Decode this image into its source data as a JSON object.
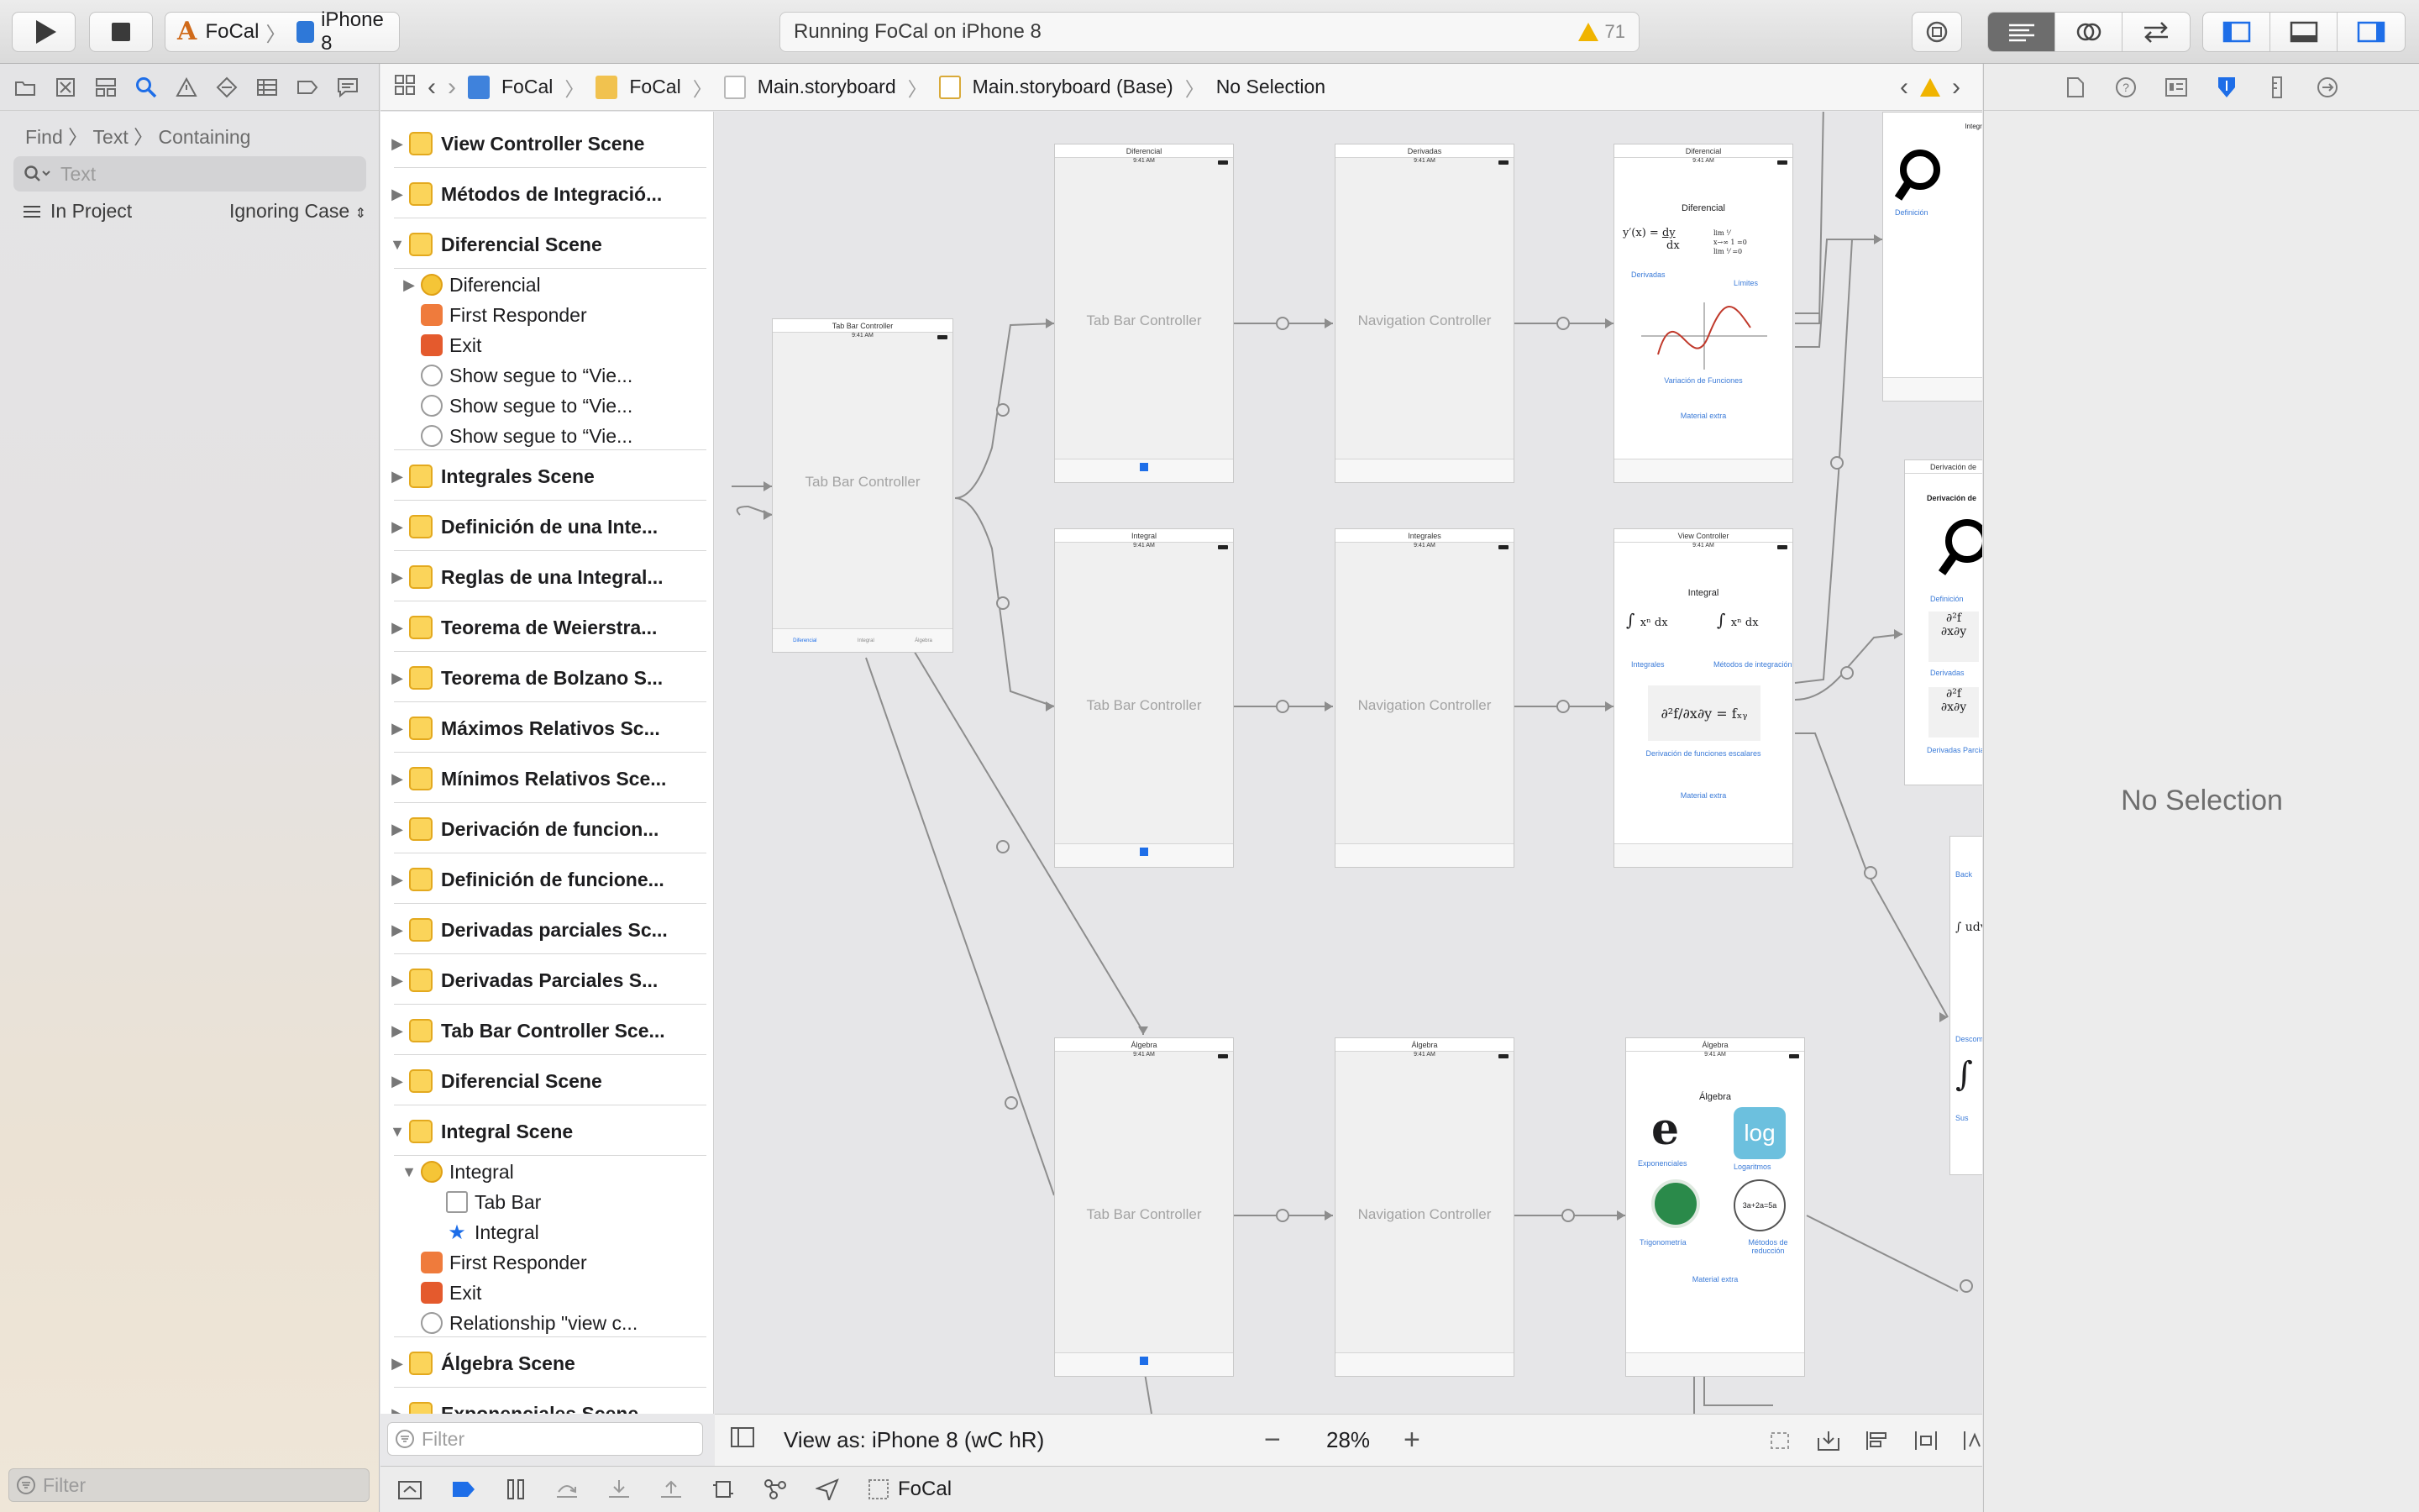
{
  "toolbar": {
    "scheme_app": "FoCal",
    "scheme_device": "iPhone 8",
    "status_text": "Running FoCal on iPhone 8",
    "warning_count": "71"
  },
  "navigator": {
    "find_path": [
      "Find",
      "Text",
      "Containing"
    ],
    "search_placeholder": "Text",
    "scope": "In Project",
    "case_option": "Ignoring Case",
    "filter_placeholder": "Filter"
  },
  "jumpbar": {
    "items": [
      "FoCal",
      "FoCal",
      "Main.storyboard",
      "Main.storyboard (Base)",
      "No Selection"
    ]
  },
  "outline": {
    "rows": [
      {
        "label": "View Controller Scene",
        "kind": "scene",
        "expanded": false
      },
      {
        "label": "Métodos de Integració...",
        "kind": "scene",
        "expanded": false
      },
      {
        "label": "Diferencial Scene",
        "kind": "scene",
        "expanded": true
      },
      {
        "label": "Diferencial",
        "kind": "vc",
        "indent": 1
      },
      {
        "label": "First Responder",
        "kind": "fr",
        "indent": 1
      },
      {
        "label": "Exit",
        "kind": "exit",
        "indent": 1
      },
      {
        "label": "Show segue to “Vie...",
        "kind": "seg",
        "indent": 1
      },
      {
        "label": "Show segue to “Vie...",
        "kind": "seg",
        "indent": 1
      },
      {
        "label": "Show segue to “Vie...",
        "kind": "seg",
        "indent": 1
      },
      {
        "label": "Integrales Scene",
        "kind": "scene",
        "expanded": false
      },
      {
        "label": "Definición de una Inte...",
        "kind": "scene",
        "expanded": false
      },
      {
        "label": "Reglas de una Integral...",
        "kind": "scene",
        "expanded": false
      },
      {
        "label": "Teorema de Weierstra...",
        "kind": "scene",
        "expanded": false
      },
      {
        "label": "Teorema de Bolzano S...",
        "kind": "scene",
        "expanded": false
      },
      {
        "label": "Máximos Relativos Sc...",
        "kind": "scene",
        "expanded": false
      },
      {
        "label": "Mínimos Relativos Sce...",
        "kind": "scene",
        "expanded": false
      },
      {
        "label": "Derivación de funcion...",
        "kind": "scene",
        "expanded": false
      },
      {
        "label": "Definición de funcione...",
        "kind": "scene",
        "expanded": false
      },
      {
        "label": "Derivadas parciales Sc...",
        "kind": "scene",
        "expanded": false
      },
      {
        "label": "Derivadas Parciales S...",
        "kind": "scene",
        "expanded": false
      },
      {
        "label": "Tab Bar Controller Sce...",
        "kind": "scene",
        "expanded": false
      },
      {
        "label": "Diferencial Scene",
        "kind": "scene",
        "expanded": false
      },
      {
        "label": "Integral Scene",
        "kind": "scene",
        "expanded": true
      },
      {
        "label": "Integral",
        "kind": "vc",
        "indent": 1,
        "expanded": true
      },
      {
        "label": "Tab Bar",
        "kind": "tab",
        "indent": 2
      },
      {
        "label": "Integral",
        "kind": "star",
        "indent": 2
      },
      {
        "label": "First Responder",
        "kind": "fr",
        "indent": 1
      },
      {
        "label": "Exit",
        "kind": "exit",
        "indent": 1
      },
      {
        "label": "Relationship \"view c...",
        "kind": "seg",
        "indent": 1
      },
      {
        "label": "Álgebra Scene",
        "kind": "scene",
        "expanded": false
      },
      {
        "label": "Exponenciales Scene",
        "kind": "scene",
        "expanded": false
      }
    ],
    "filter_placeholder": "Filter"
  },
  "canvas": {
    "status_time": "9:41 AM",
    "tab_bar_controller_label": "Tab Bar Controller",
    "navigation_controller_label": "Navigation Controller",
    "scenes": {
      "root_title": "Tab Bar Controller",
      "root_tabs": [
        "Diferencial",
        "Integral",
        "Álgebra"
      ],
      "diff_title": "Diferencial",
      "deriv_title": "Derivadas",
      "diff_vc_title": "Diferencial",
      "diff_heading": "Diferencial",
      "diff_links": [
        "Derivadas",
        "Límites",
        "Variación de Funciones",
        "Material extra"
      ],
      "int_title": "Integral",
      "integrales_title": "Integrales",
      "vc_title": "View Controller",
      "int_heading": "Integral",
      "int_links": [
        "Integrales",
        "Métodos de integración",
        "Derivación de funciones escalares",
        "Material extra"
      ],
      "alg_title": "Álgebra",
      "alg_heading": "Álgebra",
      "alg_links": [
        "Exponenciales",
        "Logaritmos",
        "Trigonometría",
        "Métodos de reducción",
        "Material extra"
      ],
      "alg_log": "log",
      "alg_red": "3a+2a=5a",
      "right_top_title": "Integral",
      "right_top_link": "Definición",
      "right_mid_title": "Derivación de",
      "right_mid_heading": "Derivación de",
      "right_mid_links": [
        "Definición",
        "Derivadas",
        "Derivadas Parcia"
      ],
      "right_low_back": "Back",
      "right_low_links": [
        "Descom",
        "Sus"
      ]
    },
    "view_as": "View as: iPhone 8",
    "size_class": "(wC hR)",
    "zoom": "28%"
  },
  "debug_bar": {
    "process": "FoCal"
  },
  "inspector": {
    "empty_text": "No Selection"
  },
  "colors": {
    "accent": "#1e6ee8",
    "link": "#3b7bd8",
    "scene_icon": "#fbd45a",
    "warning": "#f0b400"
  }
}
